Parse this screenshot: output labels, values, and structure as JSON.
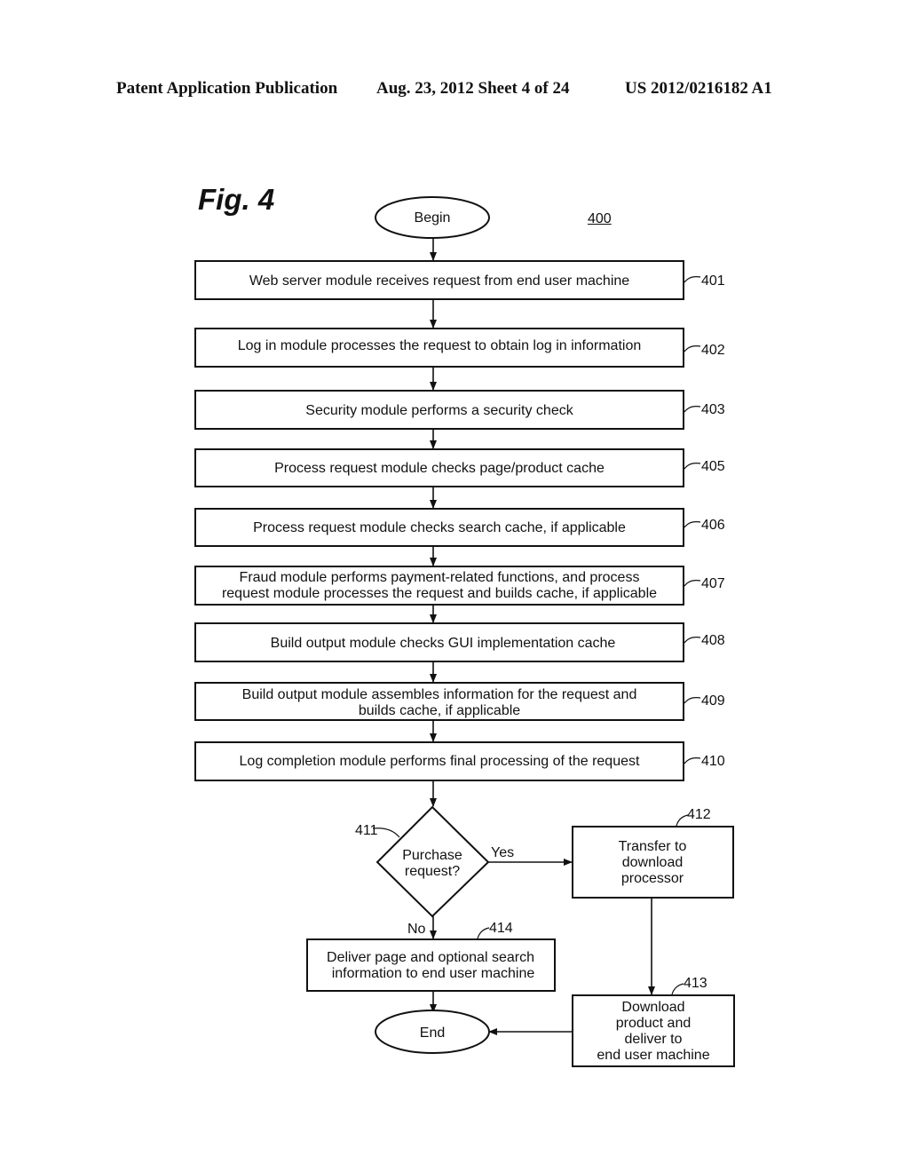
{
  "header": {
    "publication": "Patent Application Publication",
    "date_sheet": "Aug. 23, 2012  Sheet 4 of 24",
    "patent_number": "US 2012/0216182 A1"
  },
  "figure": {
    "title": "Fig. 4",
    "reference": "400"
  },
  "nodes": {
    "begin": {
      "label": "Begin"
    },
    "step401": {
      "ref": "401",
      "lines": [
        "Web server module receives request from end user machine"
      ]
    },
    "step402": {
      "ref": "402",
      "lines": [
        "Log in module processes the request to obtain log in information"
      ]
    },
    "step403": {
      "ref": "403",
      "lines": [
        "Security module performs a security check"
      ]
    },
    "step405": {
      "ref": "405",
      "lines": [
        "Process request module checks page/product cache"
      ]
    },
    "step406": {
      "ref": "406",
      "lines": [
        "Process request module checks search cache, if applicable"
      ]
    },
    "step407": {
      "ref": "407",
      "lines": [
        "Fraud module performs payment-related functions, and process",
        "request module processes the request and builds cache, if applicable"
      ]
    },
    "step408": {
      "ref": "408",
      "lines": [
        "Build output module checks GUI implementation cache"
      ]
    },
    "step409": {
      "ref": "409",
      "lines": [
        "Build output module assembles information for the request and",
        "builds cache, if applicable"
      ]
    },
    "step410": {
      "ref": "410",
      "lines": [
        "Log completion module performs final processing of the request"
      ]
    },
    "decision411": {
      "ref": "411",
      "lines": [
        "Purchase",
        "request?"
      ],
      "yes_label": "Yes",
      "no_label": "No"
    },
    "step412": {
      "ref": "412",
      "lines": [
        "Transfer to",
        "download",
        "processor"
      ]
    },
    "step413": {
      "ref": "413",
      "lines": [
        "Download",
        "product and",
        "deliver to",
        "end user machine"
      ]
    },
    "step414": {
      "ref": "414",
      "lines": [
        "Deliver page and optional search",
        "information to end user machine"
      ]
    },
    "end": {
      "label": "End"
    }
  }
}
